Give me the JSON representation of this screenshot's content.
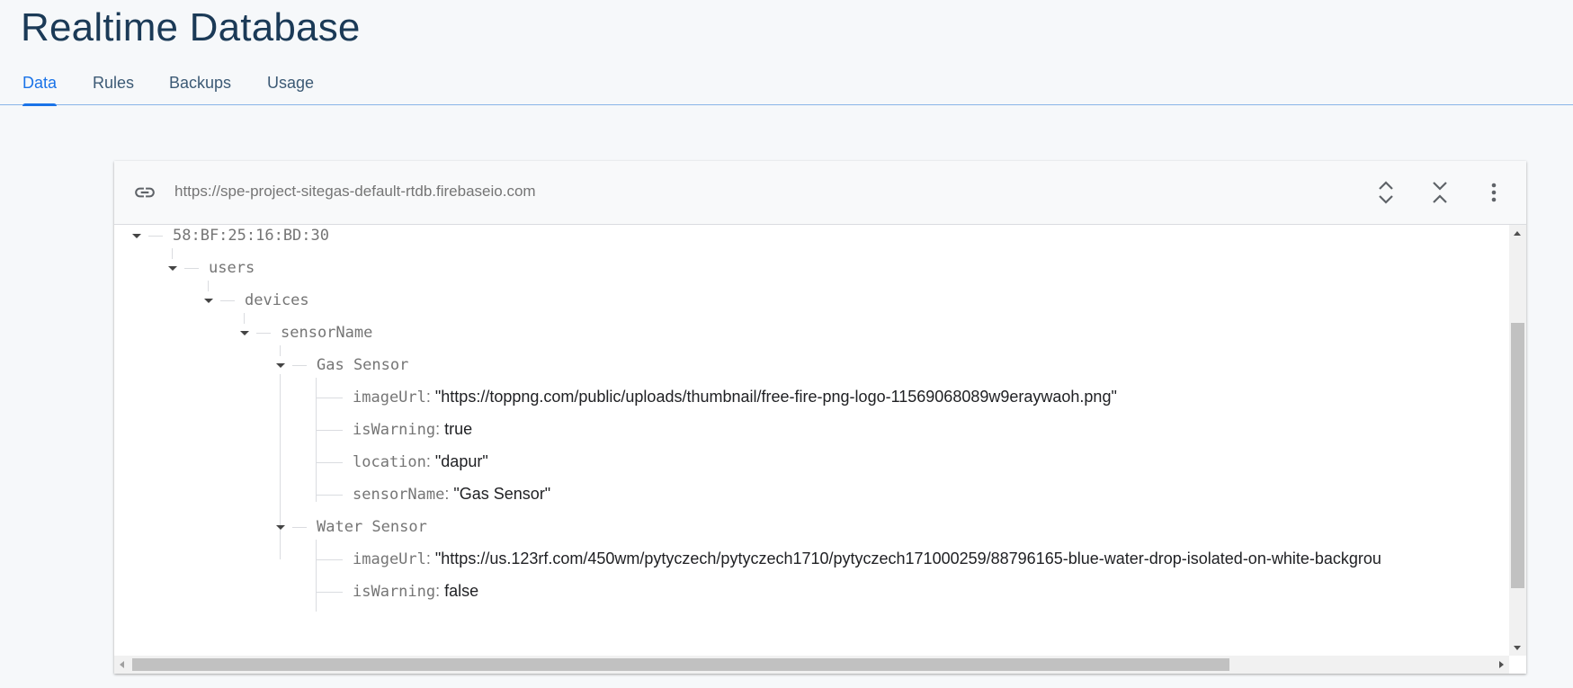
{
  "page": {
    "title": "Realtime Database"
  },
  "tabs": [
    {
      "label": "Data",
      "active": true
    },
    {
      "label": "Rules",
      "active": false
    },
    {
      "label": "Backups",
      "active": false
    },
    {
      "label": "Usage",
      "active": false
    }
  ],
  "panel": {
    "url": "https://spe-project-sitegas-default-rtdb.firebaseio.com",
    "icons": {
      "link": "link-icon",
      "expand": "expand-all-icon",
      "collapse": "collapse-all-icon",
      "more": "more-vert-icon"
    }
  },
  "tree": {
    "root": "58:BF:25:16:BD:30",
    "users": "users",
    "devices": "devices",
    "sensorName": "sensorName",
    "gas": {
      "key": "Gas Sensor",
      "imageUrl": {
        "key": "imageUrl",
        "value": "\"https://toppng.com/public/uploads/thumbnail/free-fire-png-logo-11569068089w9eraywaoh.png\""
      },
      "isWarning": {
        "key": "isWarning",
        "value": "true"
      },
      "location": {
        "key": "location",
        "value": "\"dapur\""
      },
      "sensorName": {
        "key": "sensorName",
        "value": "\"Gas Sensor\""
      }
    },
    "water": {
      "key": "Water Sensor",
      "imageUrl": {
        "key": "imageUrl",
        "value": "\"https://us.123rf.com/450wm/pytyczech/pytyczech1710/pytyczech171000259/88796165-blue-water-drop-isolated-on-white-backgrou"
      },
      "isWarning": {
        "key": "isWarning",
        "value": "false"
      }
    },
    "separator": ": "
  }
}
